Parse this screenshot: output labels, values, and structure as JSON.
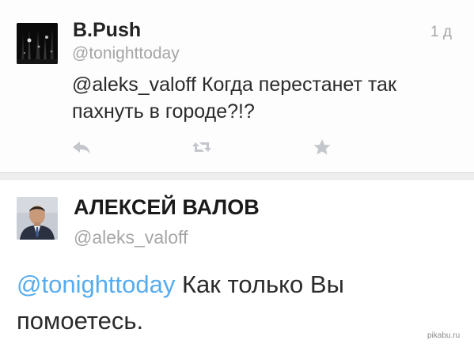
{
  "tweets": [
    {
      "author_name": "B.Push",
      "author_handle": "@tonighttoday",
      "time": "1 д",
      "text": "@aleks_valoff Когда перестанет так пахнуть в городе?!?",
      "actions": {
        "reply": "reply-icon",
        "retweet": "retweet-icon",
        "favorite": "star-icon"
      }
    },
    {
      "author_name": "АЛЕКСЕЙ ВАЛОВ",
      "author_handle": "@aleks_valoff",
      "mention": "@tonighttoday",
      "text": " Как только Вы помоетесь."
    }
  ],
  "watermark": "pikabu.ru",
  "colors": {
    "link": "#55acee",
    "muted": "#a6a6a6",
    "icon": "#c3c7cb"
  }
}
